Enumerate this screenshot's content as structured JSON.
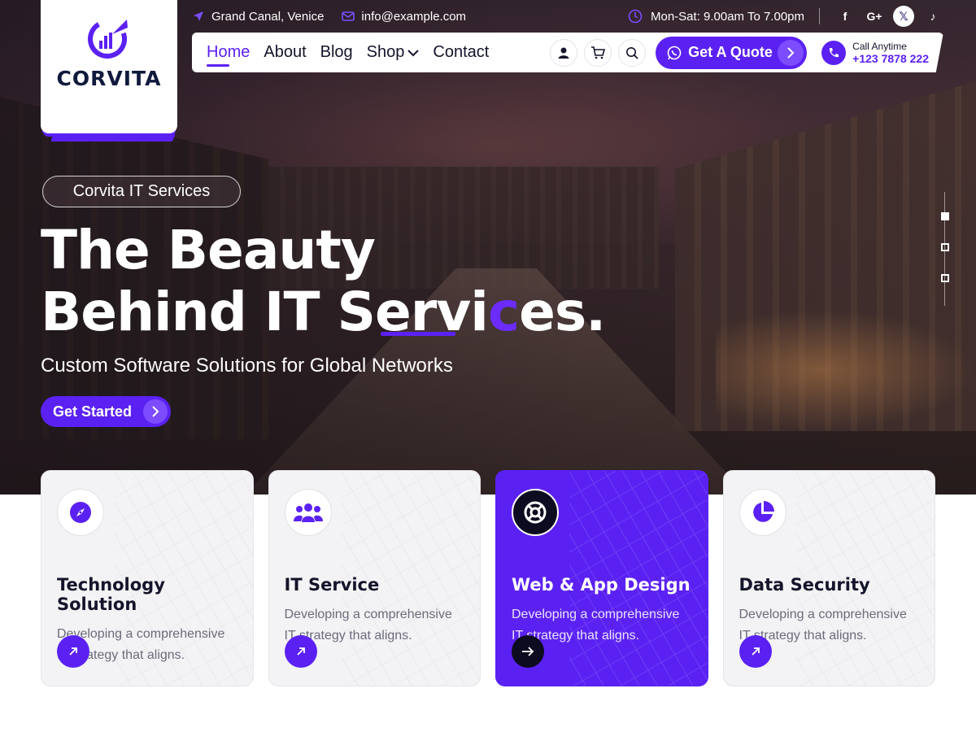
{
  "brand": {
    "name": "CORVITA",
    "accent": "#5b21f3"
  },
  "topbar": {
    "location": "Grand Canal, Venice",
    "email": "info@example.com",
    "hours": "Mon-Sat: 9.00am To 7.00pm",
    "social": [
      "facebook-icon",
      "google-plus-icon",
      "x-icon",
      "tiktok-icon"
    ]
  },
  "nav": {
    "items": [
      {
        "label": "Home",
        "active": true
      },
      {
        "label": "About"
      },
      {
        "label": "Blog"
      },
      {
        "label": "Shop",
        "dropdown": true
      },
      {
        "label": "Contact"
      }
    ],
    "quote_label": "Get A Quote",
    "call_label": "Call Anytime",
    "call_number": "+123 7878 222"
  },
  "hero": {
    "badge": "Corvita IT Services",
    "title_line1": "The Beauty",
    "title_line2_a": "Behind IT Servi",
    "title_line2_accent": "c",
    "title_line2_b": "es.",
    "subtitle": "Custom Software Solutions for Global Networks",
    "cta_label": "Get Started",
    "slider_active_index": 0,
    "slider_count": 3
  },
  "cards": [
    {
      "title": "Technology Solution",
      "text_line1": "Developing a comprehensive",
      "text_line2": "IT strategy that aligns.",
      "icon": "compass-icon"
    },
    {
      "title": "IT Service",
      "text_line1": "Developing a comprehensive",
      "text_line2": "IT strategy that aligns.",
      "icon": "users-icon"
    },
    {
      "title": "Web & App Design",
      "text_line1": "Developing a comprehensive",
      "text_line2": "IT strategy that aligns.",
      "icon": "lifebuoy-icon",
      "featured": true
    },
    {
      "title": "Data Security",
      "text_line1": "Developing a comprehensive",
      "text_line2": "IT strategy that aligns.",
      "icon": "pie-chart-icon"
    }
  ]
}
